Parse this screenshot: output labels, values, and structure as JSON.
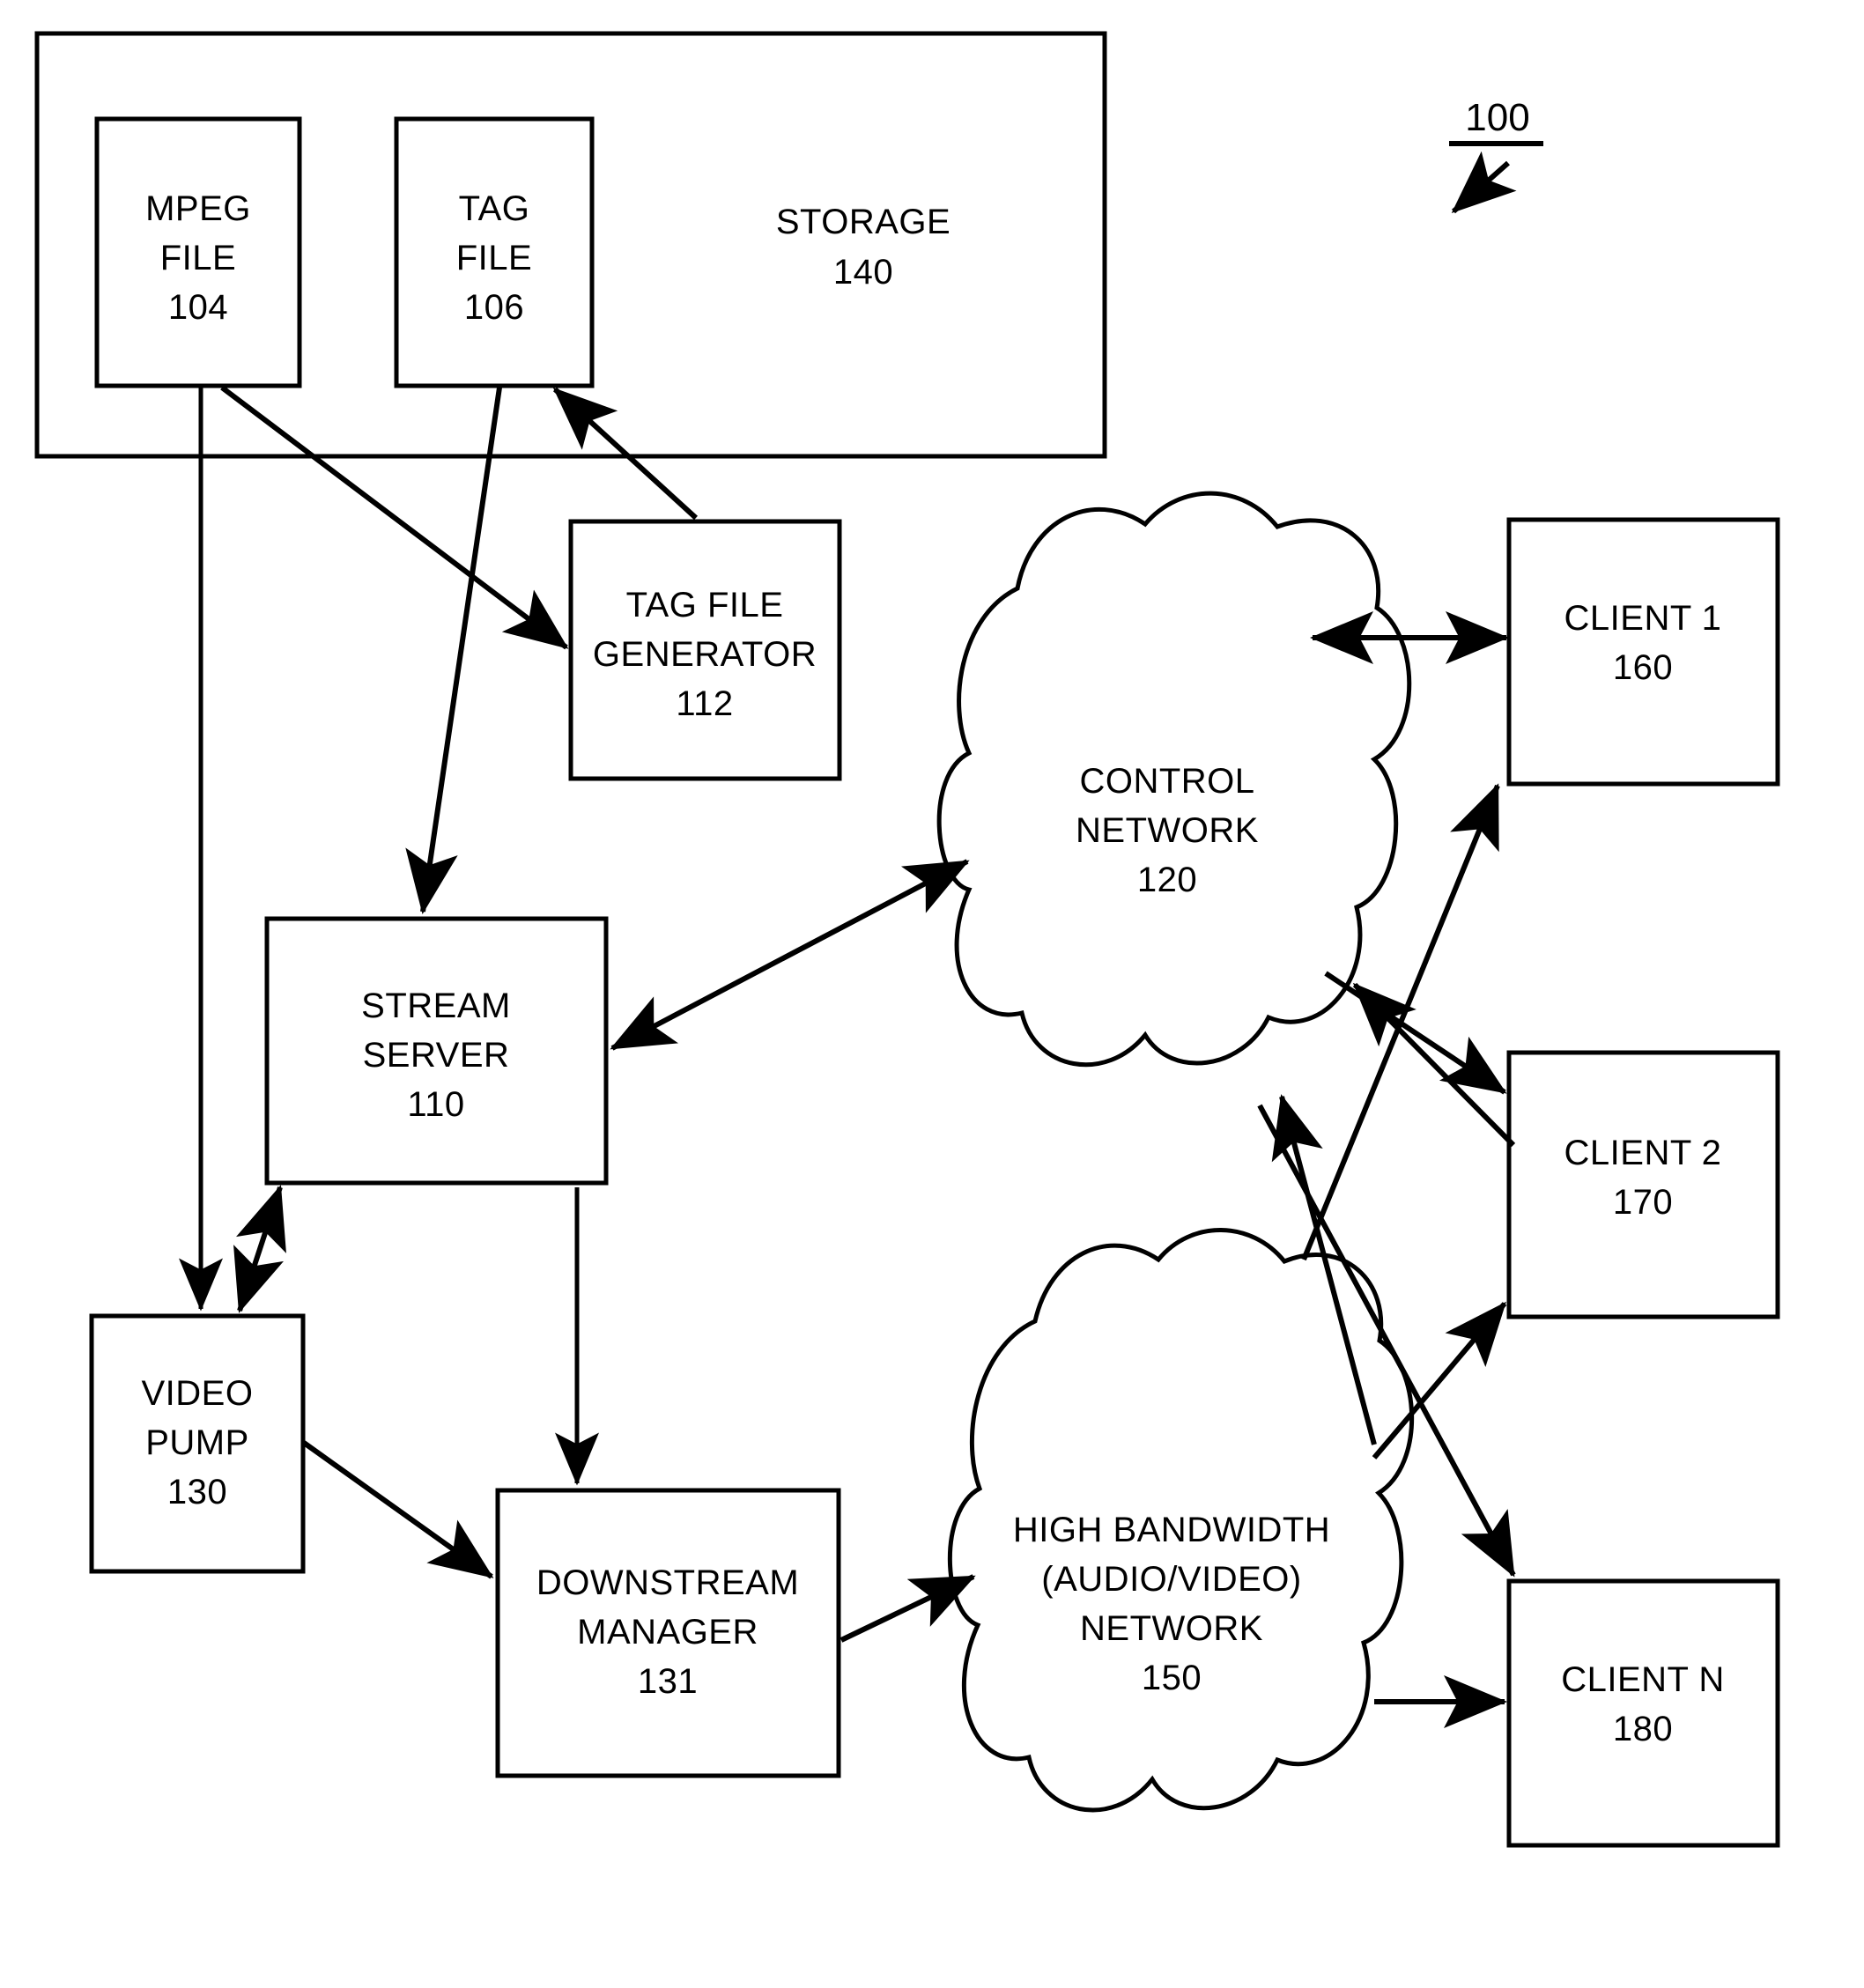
{
  "figure": {
    "reference_numeral": "100",
    "type": "patent-block-diagram"
  },
  "storage_container": {
    "label": "STORAGE",
    "numeral": "140"
  },
  "blocks": [
    {
      "id": "mpeg-file",
      "line1": "MPEG",
      "line2": "FILE",
      "line3": "104"
    },
    {
      "id": "tag-file",
      "line1": "TAG",
      "line2": "FILE",
      "line3": "106"
    },
    {
      "id": "tag-file-generator",
      "line1": "TAG FILE",
      "line2": "GENERATOR",
      "line3": "112"
    },
    {
      "id": "stream-server",
      "line1": "STREAM",
      "line2": "SERVER",
      "line3": "110"
    },
    {
      "id": "video-pump",
      "line1": "VIDEO",
      "line2": "PUMP",
      "line3": "130"
    },
    {
      "id": "downstream-manager",
      "line1": "DOWNSTREAM",
      "line2": "MANAGER",
      "line3": "131"
    },
    {
      "id": "client-1",
      "line1": "CLIENT 1",
      "line2": "160",
      "line3": ""
    },
    {
      "id": "client-2",
      "line1": "CLIENT 2",
      "line2": "170",
      "line3": ""
    },
    {
      "id": "client-n",
      "line1": "CLIENT N",
      "line2": "180",
      "line3": ""
    }
  ],
  "clouds": [
    {
      "id": "control-network",
      "line1": "CONTROL",
      "line2": "NETWORK",
      "line3": "120",
      "line4": ""
    },
    {
      "id": "high-bandwidth-network",
      "line1": "HIGH BANDWIDTH",
      "line2": "(AUDIO/VIDEO)",
      "line3": "NETWORK",
      "line4": "150"
    }
  ],
  "colors": {
    "stroke": "#000000",
    "background": "#ffffff"
  }
}
